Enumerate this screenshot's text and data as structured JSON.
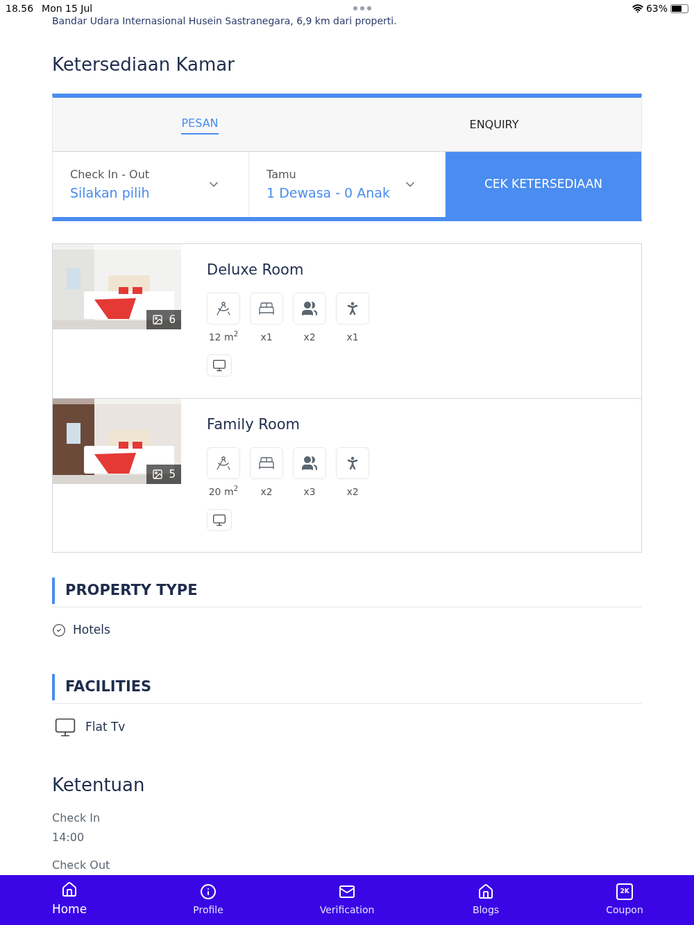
{
  "status_bar": {
    "time": "18.56",
    "date": "Mon 15 Jul",
    "battery": "63%"
  },
  "location_note": "Bandar Udara Internasional Husein Sastranegara, 6,9 km dari properti.",
  "availability": {
    "title": "Ketersediaan Kamar",
    "tabs": [
      {
        "label": "PESAN",
        "selected": true
      },
      {
        "label": "ENQUIRY",
        "selected": false
      }
    ],
    "fields": [
      {
        "label": "Check In - Out",
        "value": "Silakan pilih"
      },
      {
        "label": "Tamu",
        "value": "1 Dewasa - 0 Anak"
      }
    ],
    "button": "CEK KETERSEDIAAN"
  },
  "rooms": [
    {
      "name": "Deluxe Room",
      "photo_count": "6",
      "amenities": [
        {
          "kind": "area",
          "text": "12 m$^{2}$"
        },
        {
          "kind": "bed",
          "text": "x1"
        },
        {
          "kind": "adults",
          "text": "x2"
        },
        {
          "kind": "child",
          "text": "x1"
        }
      ],
      "facilities": [
        {
          "kind": "tv"
        }
      ]
    },
    {
      "name": "Family Room",
      "photo_count": "5",
      "amenities": [
        {
          "kind": "area",
          "text": "20 m$^{2}$"
        },
        {
          "kind": "bed",
          "text": "x2"
        },
        {
          "kind": "adults",
          "text": "x3"
        },
        {
          "kind": "child",
          "text": "x2"
        }
      ],
      "facilities": [
        {
          "kind": "tv"
        }
      ]
    }
  ],
  "property_type": {
    "title": "PROPERTY TYPE",
    "items": [
      "Hotels"
    ]
  },
  "facilities": {
    "title": "FACILITIES",
    "items": [
      {
        "kind": "tv",
        "label": "Flat Tv"
      }
    ]
  },
  "rules": {
    "title": "Ketentuan",
    "items": [
      {
        "label": "Check In",
        "value": "14:00"
      },
      {
        "label": "Check Out"
      }
    ]
  },
  "nav": [
    {
      "kind": "home",
      "label": "Home",
      "selected": true
    },
    {
      "kind": "info",
      "label": "Profile",
      "selected": false
    },
    {
      "kind": "mail",
      "label": "Verification",
      "selected": false
    },
    {
      "kind": "home",
      "label": "Blogs",
      "selected": false
    },
    {
      "kind": "coupon",
      "label": "Coupon",
      "selected": false,
      "icon_text": "2K"
    }
  ]
}
